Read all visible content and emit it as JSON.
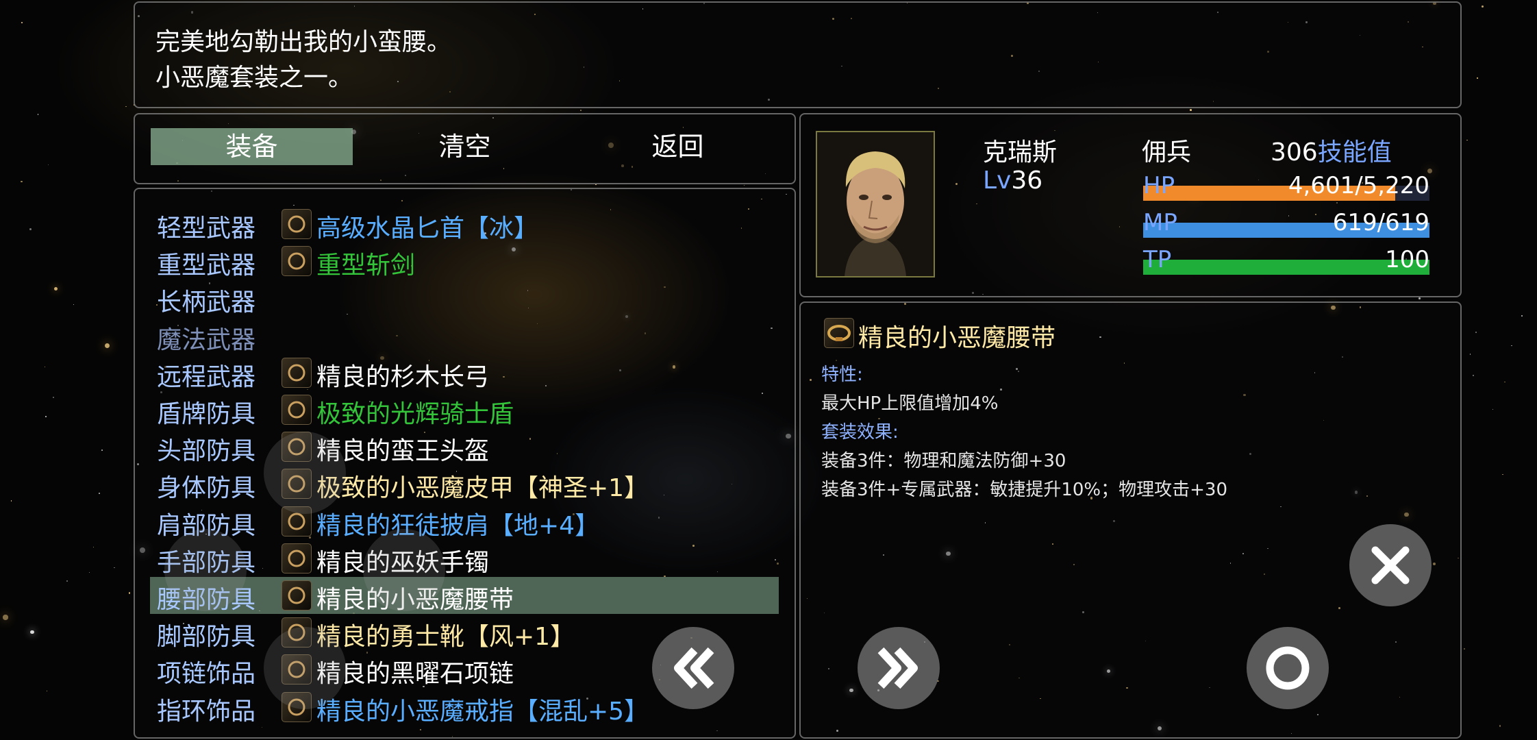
{
  "help": {
    "line1": "完美地勾勒出我的小蛮腰。",
    "line2": "小恶魔套装之一。"
  },
  "commands": {
    "equip": "装备",
    "clear": "清空",
    "back": "返回",
    "selected": "装备"
  },
  "slots": [
    {
      "slot": "轻型武器",
      "item": "高级水晶匕首【冰】",
      "item_color": "blue",
      "icon": "dagger-icon"
    },
    {
      "slot": "重型武器",
      "item": "重型斩剑",
      "item_color": "green",
      "icon": "sword-icon"
    },
    {
      "slot": "长柄武器",
      "item": "",
      "item_color": "white",
      "icon": ""
    },
    {
      "slot": "魔法武器",
      "item": "",
      "item_color": "white",
      "icon": ""
    },
    {
      "slot": "远程武器",
      "item": "精良的杉木长弓",
      "item_color": "white",
      "icon": "bow-icon"
    },
    {
      "slot": "盾牌防具",
      "item": "极致的光辉骑士盾",
      "item_color": "green",
      "icon": "shield-icon"
    },
    {
      "slot": "头部防具",
      "item": "精良的蛮王头盔",
      "item_color": "white",
      "icon": "helmet-icon"
    },
    {
      "slot": "身体防具",
      "item": "极致的小恶魔皮甲【神圣+1】",
      "item_color": "gold",
      "icon": "armor-icon"
    },
    {
      "slot": "肩部防具",
      "item": "精良的狂徒披肩【地+4】",
      "item_color": "blue",
      "icon": "shoulder-icon"
    },
    {
      "slot": "手部防具",
      "item": "精良的巫妖手镯",
      "item_color": "white",
      "icon": "bracelet-icon"
    },
    {
      "slot": "腰部防具",
      "item": "精良的小恶魔腰带",
      "item_color": "white",
      "icon": "belt-icon"
    },
    {
      "slot": "脚部防具",
      "item": "精良的勇士靴【风+1】",
      "item_color": "gold",
      "icon": "boots-icon"
    },
    {
      "slot": "项链饰品",
      "item": "精良的黑曜石项链",
      "item_color": "white",
      "icon": "necklace-icon"
    },
    {
      "slot": "指环饰品",
      "item": "精良的小恶魔戒指【混乱+5】",
      "item_color": "blue",
      "icon": "ring-icon"
    }
  ],
  "selected_slot": "腰部防具",
  "character": {
    "name": "克瑞斯",
    "class": "佣兵",
    "level_prefix": "Lv",
    "level": "36",
    "skill_points_value": "306",
    "skill_points_label": "技能值",
    "hp_label": "HP",
    "hp_value": "4,601/5,220",
    "hp_fraction": 0.881,
    "mp_label": "MP",
    "mp_value": "619/619",
    "mp_fraction": 1.0,
    "tp_label": "TP",
    "tp_value": "100",
    "tp_fraction": 1.0
  },
  "item_info": {
    "name": "精良的小恶魔腰带",
    "trait_label": "特性:",
    "trait": "最大HP上限值增加4%",
    "set_label": "套装效果:",
    "set_effect1": "装备3件：物理和魔法防御+30",
    "set_effect2": "装备3件+专属武器：敏捷提升10%；物理攻击+30"
  },
  "colors": {
    "hp_bar": "#f08a2a",
    "mp_bar": "#3f8fe0",
    "tp_bar": "#1fae3a",
    "slot_label": "#a8c8ff",
    "highlight": "#8cb496"
  }
}
